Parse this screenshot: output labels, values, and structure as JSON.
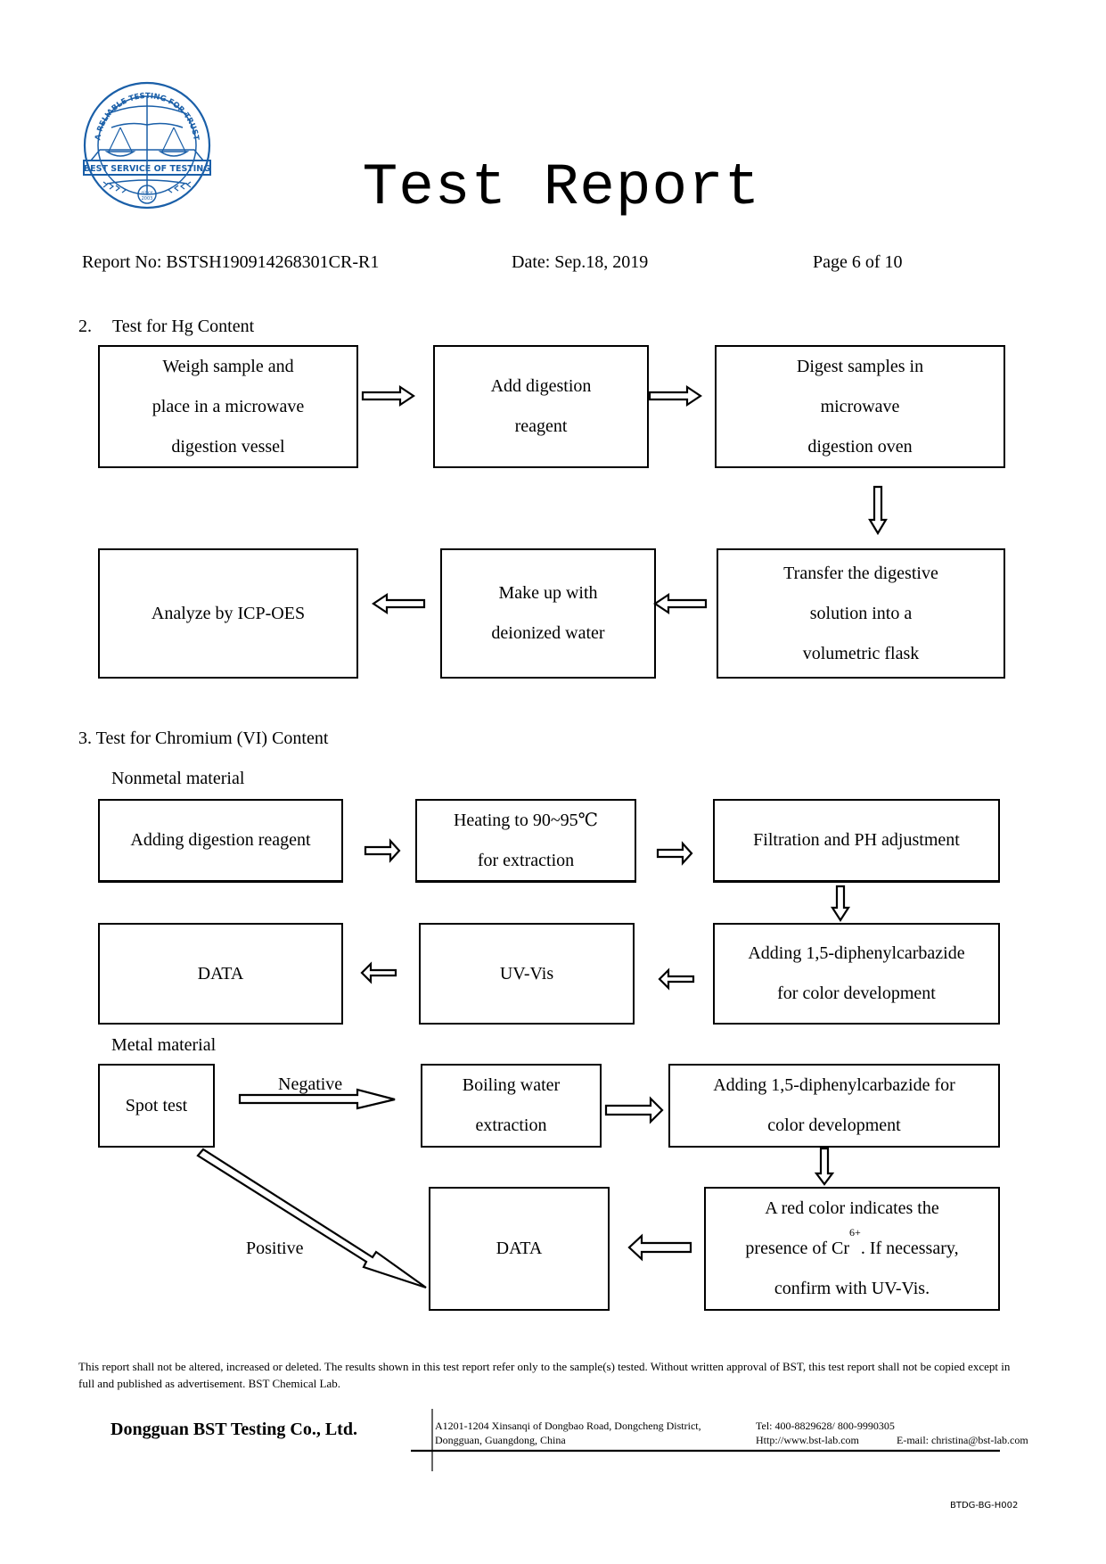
{
  "logo": {
    "arc_text": "A RELIABLE TESTING FOR TRUST",
    "banner_text": "BEST SERVICE OF TESTING",
    "since_label": "since",
    "since_year": "2003",
    "color": "#1a5fa8"
  },
  "header": {
    "title": "Test Report",
    "report_no": "Report No: BSTSH190914268301CR-R1",
    "date": "Date: Sep.18, 2019",
    "page": "Page 6 of 10"
  },
  "hg_section": {
    "heading_num": "2.",
    "heading": "Test for Hg Content",
    "steps": [
      {
        "lines": [
          "Weigh sample and",
          "place in a microwave",
          "digestion vessel"
        ]
      },
      {
        "lines": [
          "Add digestion",
          "reagent"
        ]
      },
      {
        "lines": [
          "Digest samples in",
          "microwave",
          "digestion oven"
        ]
      },
      {
        "lines": [
          "Transfer the digestive",
          "solution into a",
          "volumetric flask"
        ]
      },
      {
        "lines": [
          "Make up with",
          "deionized water"
        ]
      },
      {
        "lines": [
          "Analyze by ICP-OES"
        ]
      }
    ]
  },
  "cr_section": {
    "heading": "3. Test for Chromium (VI) Content",
    "nonmetal": {
      "label": "Nonmetal material",
      "steps": [
        {
          "lines": [
            "Adding digestion reagent"
          ]
        },
        {
          "lines": [
            "Heating to 90~95℃",
            "for extraction"
          ]
        },
        {
          "lines": [
            "Filtration and PH adjustment"
          ]
        },
        {
          "lines": [
            "Adding 1,5-diphenylcarbazide",
            "for color development"
          ]
        },
        {
          "lines": [
            "UV-Vis"
          ]
        },
        {
          "lines": [
            "DATA"
          ]
        }
      ]
    },
    "metal": {
      "label": "Metal material",
      "negative_label": "Negative",
      "positive_label": "Positive",
      "steps": [
        {
          "lines": [
            "Spot test"
          ]
        },
        {
          "lines": [
            "Boiling water",
            "extraction"
          ]
        },
        {
          "lines": [
            "Adding 1,5-diphenylcarbazide for",
            "color development"
          ]
        },
        {
          "line1": "A red color indicates the",
          "line2_pre": "presence of Cr",
          "line2_sup": "6+",
          "line2_post": ". If necessary,",
          "line3": "confirm with UV-Vis."
        },
        {
          "lines": [
            "DATA"
          ]
        }
      ]
    }
  },
  "footer": {
    "disclaimer": "This report shall not be altered, increased or deleted. The results shown in this test report refer only to the sample(s) tested. Without written approval of BST, this test report shall not be copied except in full and published as advertisement. BST Chemical Lab.",
    "company": "Dongguan BST Testing Co., Ltd.",
    "address_line1": "A1201-1204 Xinsanqi of Dongbao Road, Dongcheng District,",
    "address_line2": "Dongguan, Guangdong, China",
    "tel": "Tel: 400-8829628/ 800-9990305",
    "website": "Http://www.bst-lab.com",
    "email": "E-mail: christina@bst-lab.com",
    "form_code": "BTDG-BG-H002"
  }
}
